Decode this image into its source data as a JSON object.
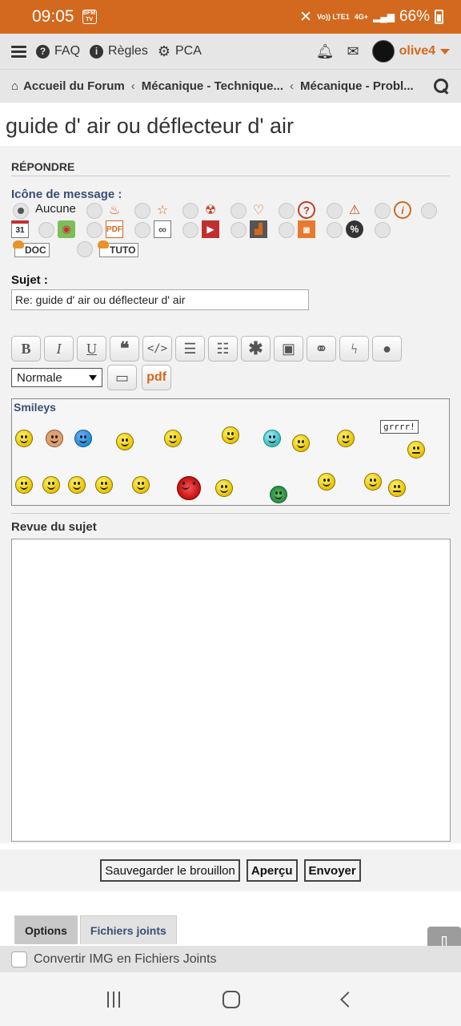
{
  "status_bar": {
    "time": "09:05",
    "app_badge": "BFM TV",
    "network": "Vo)) LTE1",
    "signal": "4G+",
    "battery": "66%"
  },
  "topnav": {
    "faq": "FAQ",
    "rules": "Règles",
    "pca": "PCA",
    "username": "olive4"
  },
  "breadcrumb": [
    "Accueil du Forum",
    "Mécanique - Technique...",
    "Mécanique - Probl..."
  ],
  "page_title": "guide d' air ou déflecteur d' air",
  "reply": {
    "heading": "RÉPONDRE",
    "icon_label": "Icône de message :",
    "icon_none": "Aucune",
    "icons": [
      "fire-icon",
      "star-icon",
      "radiation-icon",
      "heart-icon",
      "question-icon",
      "warning-icon",
      "info-icon",
      "calendar-icon",
      "map-icon",
      "pdf-icon",
      "link-icon",
      "video-icon",
      "chart-icon",
      "camera-icon",
      "percent-icon"
    ],
    "calendar_day": "31",
    "tag_doc": "DOC",
    "tag_tuto": "TUTO",
    "subject_label": "Sujet :",
    "subject_value": "Re: guide d' air ou déflecteur d' air",
    "font_size": "Normale",
    "pdf": "pdf",
    "smileys_title": "Smileys",
    "smiley_sign": "grrrr!",
    "review_label": "Revue du sujet"
  },
  "actions": {
    "save_draft": "Sauvegarder le brouillon",
    "preview": "Aperçu",
    "send": "Envoyer"
  },
  "tabs": [
    "Options",
    "Fichiers joints"
  ],
  "option_checkbox": "Convertir IMG en Fichiers Joints",
  "colors": {
    "accent": "#d2691e",
    "link": "#3a4f74"
  }
}
